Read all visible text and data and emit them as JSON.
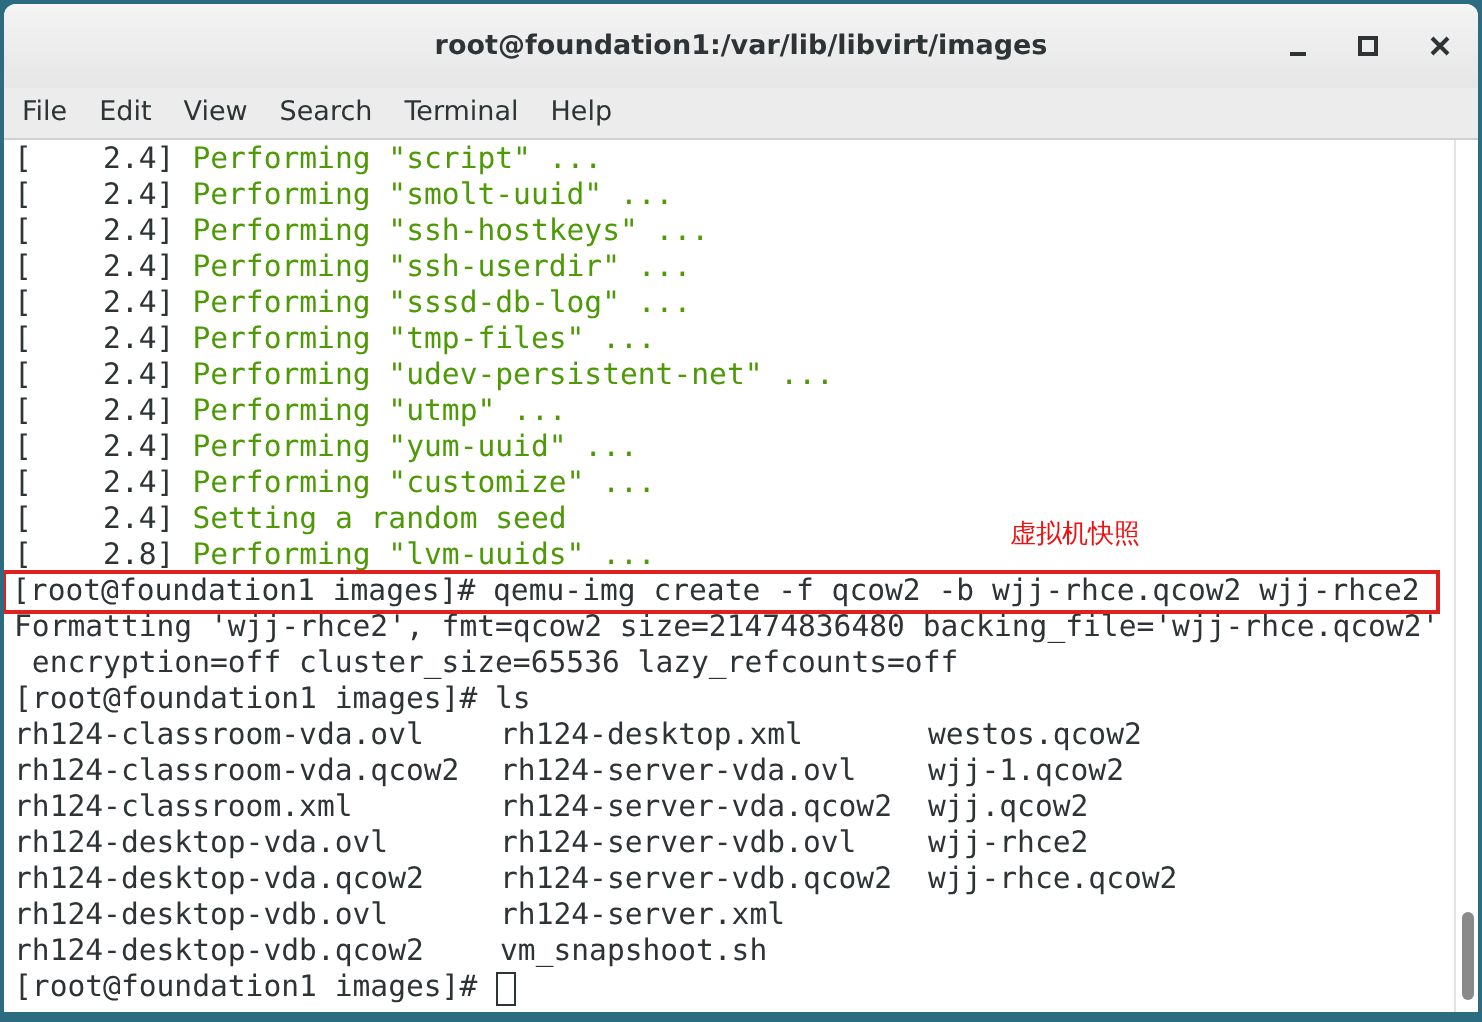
{
  "window": {
    "title": "root@foundation1:/var/lib/libvirt/images"
  },
  "menu": [
    "File",
    "Edit",
    "View",
    "Search",
    "Terminal",
    "Help"
  ],
  "terminal": {
    "lines": [
      {
        "kind": "boot",
        "prefix": "[    2.4]",
        "message": "Performing \"script\" ..."
      },
      {
        "kind": "boot",
        "prefix": "[    2.4]",
        "message": "Performing \"smolt-uuid\" ..."
      },
      {
        "kind": "boot",
        "prefix": "[    2.4]",
        "message": "Performing \"ssh-hostkeys\" ..."
      },
      {
        "kind": "boot",
        "prefix": "[    2.4]",
        "message": "Performing \"ssh-userdir\" ..."
      },
      {
        "kind": "boot",
        "prefix": "[    2.4]",
        "message": "Performing \"sssd-db-log\" ..."
      },
      {
        "kind": "boot",
        "prefix": "[    2.4]",
        "message": "Performing \"tmp-files\" ..."
      },
      {
        "kind": "boot",
        "prefix": "[    2.4]",
        "message": "Performing \"udev-persistent-net\" ..."
      },
      {
        "kind": "boot",
        "prefix": "[    2.4]",
        "message": "Performing \"utmp\" ..."
      },
      {
        "kind": "boot",
        "prefix": "[    2.4]",
        "message": "Performing \"yum-uuid\" ..."
      },
      {
        "kind": "boot",
        "prefix": "[    2.4]",
        "message": "Performing \"customize\" ..."
      },
      {
        "kind": "boot",
        "prefix": "[    2.4]",
        "message": "Setting a random seed"
      },
      {
        "kind": "boot",
        "prefix": "[    2.8]",
        "message": "Performing \"lvm-uuids\" ..."
      },
      {
        "kind": "command",
        "text": "[root@foundation1 images]# qemu-img create -f qcow2 -b wjj-rhce.qcow2 wjj-rhce2",
        "highlighted": true,
        "annotation": "虚拟机快照"
      },
      {
        "kind": "output",
        "text": "Formatting 'wjj-rhce2', fmt=qcow2 size=21474836480 backing_file='wjj-rhce.qcow2'"
      },
      {
        "kind": "output",
        "text": " encryption=off cluster_size=65536 lazy_refcounts=off"
      },
      {
        "kind": "command",
        "text": "[root@foundation1 images]# ls",
        "highlighted": false
      },
      {
        "kind": "listing",
        "rows": [
          [
            "rh124-classroom-vda.ovl",
            "rh124-desktop.xml",
            "westos.qcow2"
          ],
          [
            "rh124-classroom-vda.qcow2",
            "rh124-server-vda.ovl",
            "wjj-1.qcow2"
          ],
          [
            "rh124-classroom.xml",
            "rh124-server-vda.qcow2",
            "wjj.qcow2"
          ],
          [
            "rh124-desktop-vda.ovl",
            "rh124-server-vdb.ovl",
            "wjj-rhce2"
          ],
          [
            "rh124-desktop-vda.qcow2",
            "rh124-server-vdb.qcow2",
            "wjj-rhce.qcow2"
          ],
          [
            "rh124-desktop-vdb.ovl",
            "rh124-server.xml"
          ],
          [
            "rh124-desktop-vdb.qcow2",
            "vm_snapshoot.sh"
          ]
        ]
      },
      {
        "kind": "prompt",
        "text": "[root@foundation1 images]#"
      }
    ]
  }
}
